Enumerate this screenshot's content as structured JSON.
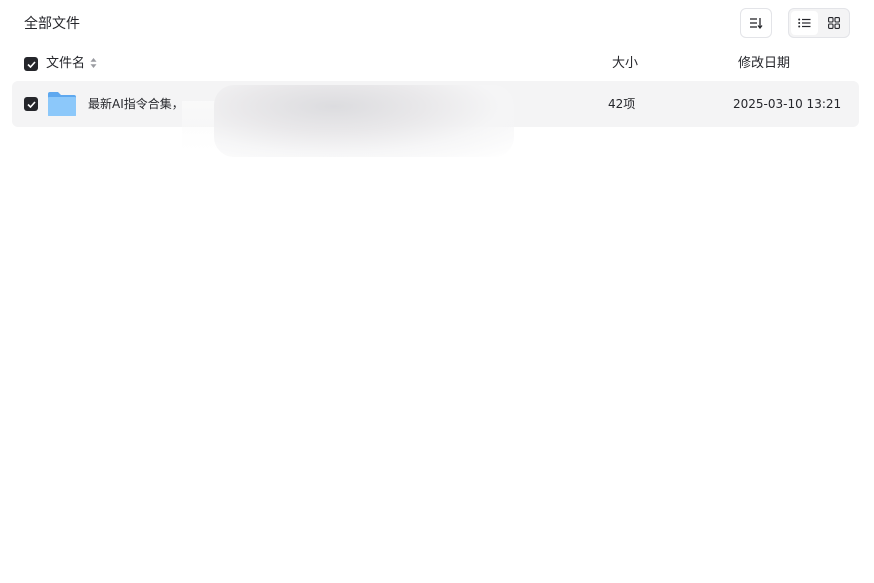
{
  "breadcrumb": {
    "title": "全部文件"
  },
  "toolbar": {
    "sort_icon": "sort-icon",
    "view_modes": [
      {
        "name": "list-view",
        "icon": "list-icon",
        "active": true
      },
      {
        "name": "grid-view",
        "icon": "grid-icon",
        "active": false
      }
    ]
  },
  "table": {
    "columns": {
      "name": "文件名",
      "size": "大小",
      "modified": "修改日期"
    },
    "rows": [
      {
        "icon": "folder-icon",
        "name": "最新AI指令合集，",
        "size": "42项",
        "modified": "2025-03-10 13:21",
        "selected": true
      }
    ]
  },
  "colors": {
    "accent": "#25262b",
    "row_bg": "#f4f4f5",
    "folder": "#6fb5f5"
  }
}
